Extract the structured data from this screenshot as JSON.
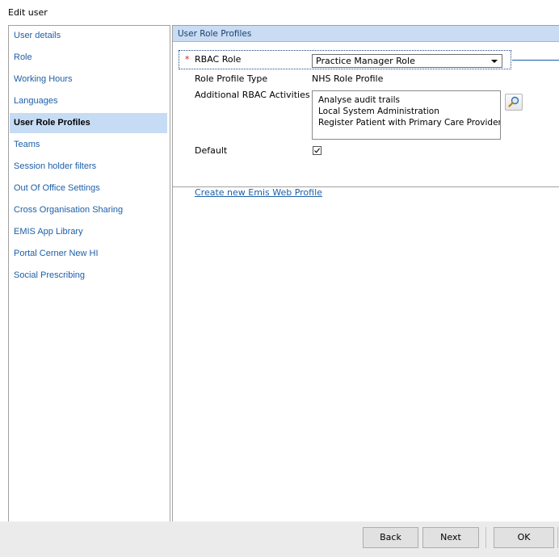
{
  "window": {
    "title": "Edit user"
  },
  "sidebar": {
    "items": [
      {
        "label": "User details"
      },
      {
        "label": "Role"
      },
      {
        "label": "Working Hours"
      },
      {
        "label": "Languages"
      },
      {
        "label": "User Role Profiles",
        "selected": true
      },
      {
        "label": "Teams"
      },
      {
        "label": "Session holder filters"
      },
      {
        "label": "Out Of Office Settings"
      },
      {
        "label": "Cross Organisation Sharing"
      },
      {
        "label": "EMIS App Library"
      },
      {
        "label": "Portal Cerner New HI"
      },
      {
        "label": "Social Prescribing"
      }
    ]
  },
  "panel": {
    "title": "User Role Profiles",
    "rbac_role": {
      "label": "RBAC Role",
      "value": "Practice Manager Role",
      "required": true
    },
    "role_profile_type": {
      "label": "Role Profile Type",
      "value": "NHS Role Profile"
    },
    "additional_activities": {
      "label": "Additional RBAC Activities",
      "items": [
        "Analyse audit trails",
        "Local System Administration",
        "Register Patient with Primary Care Provider o..."
      ]
    },
    "default": {
      "label": "Default",
      "checked": true
    },
    "create_link": "Create new Emis Web Profile"
  },
  "footer": {
    "back_label": "Back",
    "next_label": "Next",
    "ok_label": "OK"
  },
  "colors": {
    "accent_link": "#1e5fa8",
    "selected_bg": "#c6dcf5",
    "header_bg": "#c9dcf3",
    "required": "#d02020"
  },
  "icons": {
    "lookup": "magnifier-icon",
    "dropdown": "chevron-down-icon",
    "checkbox": "checkmark-icon"
  }
}
